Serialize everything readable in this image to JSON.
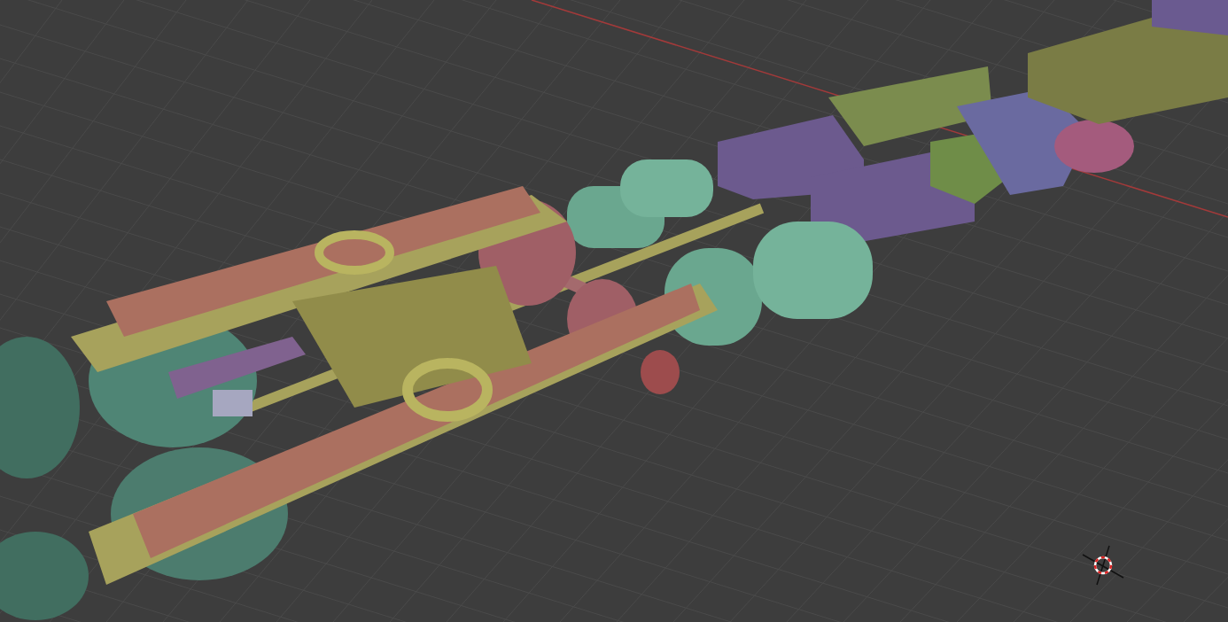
{
  "viewport": {
    "kind": "render",
    "cursor_visible": true
  }
}
